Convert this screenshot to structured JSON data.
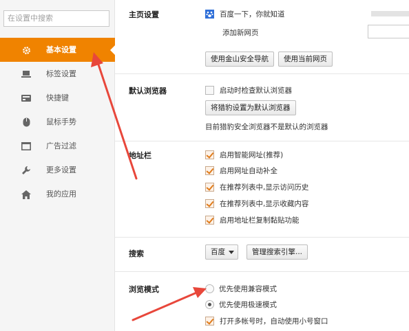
{
  "sidebar": {
    "search_placeholder": "在设置中搜索",
    "items": [
      {
        "label": "基本设置",
        "icon": "gear-icon"
      },
      {
        "label": "标签设置",
        "icon": "laptop-icon"
      },
      {
        "label": "快捷键",
        "icon": "keyboard-icon"
      },
      {
        "label": "鼠标手势",
        "icon": "mouse-icon"
      },
      {
        "label": "广告过滤",
        "icon": "window-icon"
      },
      {
        "label": "更多设置",
        "icon": "wrench-icon"
      },
      {
        "label": "我的应用",
        "icon": "home-icon"
      }
    ],
    "active_color": "#f08300"
  },
  "homepage": {
    "title": "主页设置",
    "page_label": "百度一下，你就知道",
    "add_label": "添加新网页",
    "btn_safe_nav": "使用金山安全导航",
    "btn_current": "使用当前网页"
  },
  "default_browser": {
    "title": "默认浏览器",
    "check_on_start": "启动时检查默认浏览器",
    "btn_set_default": "将猎豹设置为默认浏览器",
    "status": "目前猎豹安全浏览器不是默认的浏览器"
  },
  "address_bar": {
    "title": "地址栏",
    "options": [
      "启用智能网址(推荐)",
      "启用网址自动补全",
      "在推荐列表中,显示访问历史",
      "在推荐列表中,显示收藏内容",
      "启用地址栏复制黏贴功能"
    ]
  },
  "search": {
    "title": "搜索",
    "engine": "百度",
    "btn_manage": "管理搜索引擎..."
  },
  "browse_mode": {
    "title": "浏览模式",
    "option_compat": "优先使用兼容模式",
    "option_fast": "优先使用极速模式",
    "multi_account": "打开多帐号时，自动使用小号窗口"
  },
  "annotation_color": "#e8473b"
}
